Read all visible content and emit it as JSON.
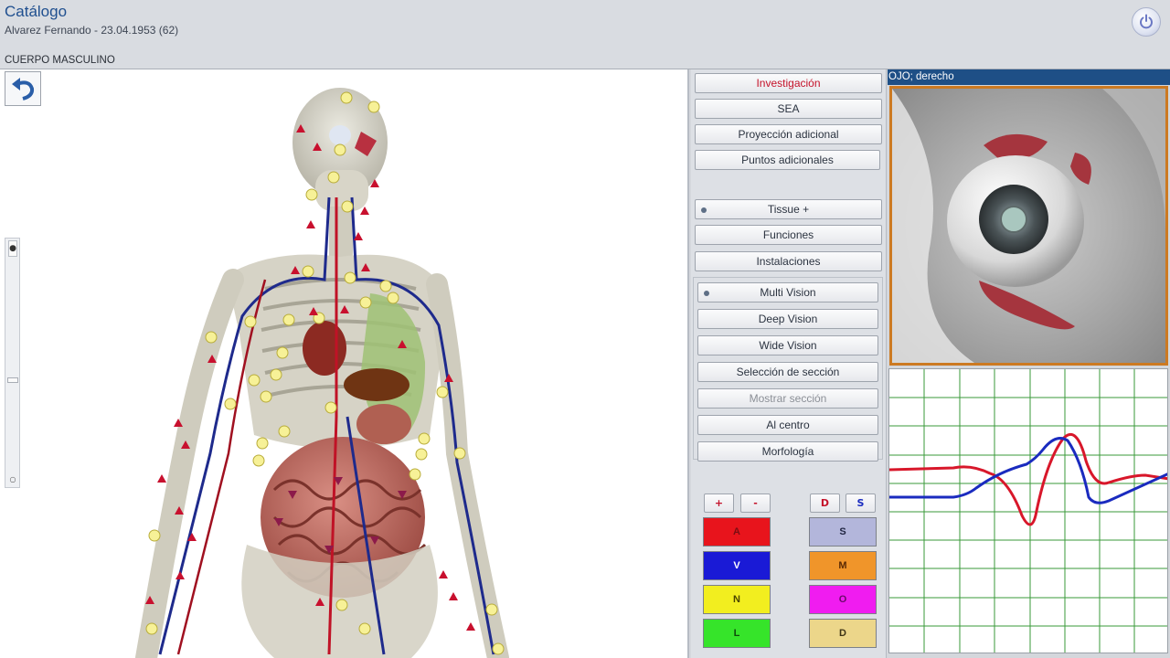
{
  "header": {
    "title": "Catálogo",
    "patient": "Alvarez  Fernando   -   23.04.1953 (62)",
    "section": "CUERPO MASCULINO"
  },
  "panel": {
    "top_buttons": [
      "Investigación",
      "SEA",
      "Proyección adicional",
      "Puntos adicionales"
    ],
    "mid_buttons": [
      "Tissue +",
      "Funciones",
      "Instalaciones"
    ],
    "vision_buttons": [
      "Multi Vision",
      "Deep Vision",
      "Wide Vision",
      "Selección de sección",
      "Mostrar sección",
      "Al centro",
      "Morfología"
    ],
    "small_buttons": [
      "+",
      "-",
      "D",
      "S"
    ],
    "color_buttons": [
      {
        "label": "A",
        "color": "#e8141c",
        "text": "#7a0d12"
      },
      {
        "label": "S",
        "color": "#b3b6db",
        "text": "#1f2440"
      },
      {
        "label": "V",
        "color": "#1a1ad6",
        "text": "#ffffff"
      },
      {
        "label": "M",
        "color": "#f0952a",
        "text": "#5a2a05"
      },
      {
        "label": "N",
        "color": "#f2ee1f",
        "text": "#4a4400"
      },
      {
        "label": "O",
        "color": "#f01cf0",
        "text": "#6a0a6a"
      },
      {
        "label": "L",
        "color": "#36e42a",
        "text": "#0f4a0c"
      },
      {
        "label": "D",
        "color": "#ecd68a",
        "text": "#3e3416"
      }
    ]
  },
  "eye_panel": {
    "heading": "OJO; derecho"
  },
  "colors": {
    "header_bg": "#d9dce1",
    "accent_blue": "#1e4f86",
    "red_text": "#c4122a",
    "frame_orange": "#cc7a22",
    "red_curve": "#d8172a",
    "blue_curve": "#1a2bbf"
  }
}
